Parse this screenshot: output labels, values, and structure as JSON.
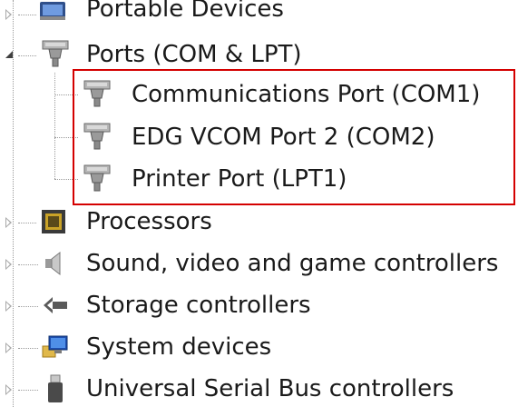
{
  "tree": {
    "items": [
      {
        "label": "Portable Devices",
        "icon": "portable-device-icon",
        "state": "collapsed"
      },
      {
        "label": "Ports (COM & LPT)",
        "icon": "port-connector-icon",
        "state": "expanded",
        "children": [
          {
            "label": "Communications Port (COM1)",
            "icon": "port-connector-icon"
          },
          {
            "label": "EDG VCOM Port 2 (COM2)",
            "icon": "port-connector-icon"
          },
          {
            "label": "Printer Port (LPT1)",
            "icon": "port-connector-icon"
          }
        ]
      },
      {
        "label": "Processors",
        "icon": "processor-chip-icon",
        "state": "collapsed"
      },
      {
        "label": "Sound, video and game controllers",
        "icon": "speaker-icon",
        "state": "collapsed"
      },
      {
        "label": "Storage controllers",
        "icon": "storage-controller-icon",
        "state": "collapsed"
      },
      {
        "label": "System devices",
        "icon": "monitor-folder-icon",
        "state": "collapsed"
      },
      {
        "label": "Universal Serial Bus controllers",
        "icon": "usb-plug-icon",
        "state": "collapsed"
      }
    ]
  },
  "highlight": {
    "color": "#d40000"
  }
}
